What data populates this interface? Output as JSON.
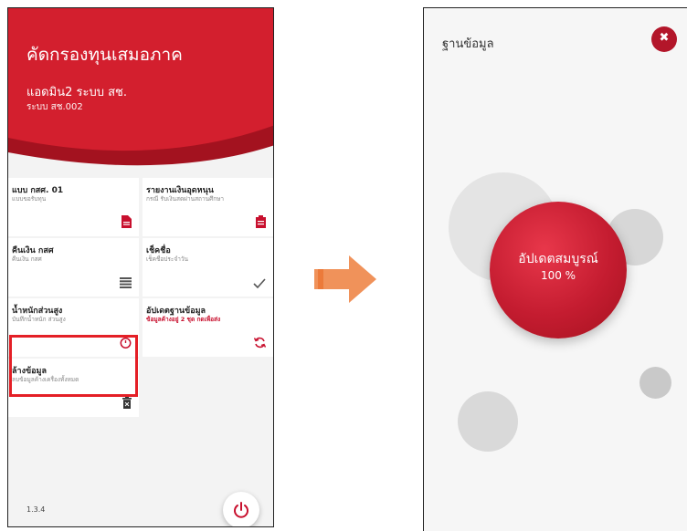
{
  "left_screen": {
    "title": "คัดกรองทุนเสมอภาค",
    "user_name": "แอดมิน2 ระบบ สช.",
    "user_id": "ระบบ สช.002",
    "menu": [
      {
        "title": "แบบ กสศ. 01",
        "desc": "แบบขอรับทุน",
        "icon": "document-icon"
      },
      {
        "title": "รายงานเงินอุดหนุน",
        "desc": "กรณี รับเงินสดผ่านสถานศึกษา",
        "icon": "clipboard-icon"
      },
      {
        "title": "คืนเงิน กสศ",
        "desc": "คืนเงิน กสศ",
        "icon": "list-icon"
      },
      {
        "title": "เช็คชื่อ",
        "desc": "เช็คชื่อประจำวัน",
        "icon": "check-icon"
      },
      {
        "title": "น้ำหนักส่วนสูง",
        "desc": "บันทึกน้ำหนัก ส่วนสูง",
        "icon": "stopwatch-icon"
      },
      {
        "title": "อัปเดตฐานข้อมูล",
        "desc": "ข้อมูลค้างอยู่ 2 ชุด กดเพื่อส่ง",
        "icon": "sync-icon",
        "desc_color": "#c8102e"
      },
      {
        "title": "ล้างข้อมูล",
        "desc": "ลบข้อมูลค้างเครื่องทั้งหมด",
        "icon": "trash-icon"
      }
    ],
    "version": "1.3.4"
  },
  "right_screen": {
    "title": "ฐานข้อมูล",
    "close_symbol": "✖",
    "status_text": "อัปเดตสมบูรณ์",
    "progress": "100 %"
  },
  "colors": {
    "brand_red": "#c8102e",
    "highlight": "#e41f26",
    "arrow": "#f0925a"
  }
}
